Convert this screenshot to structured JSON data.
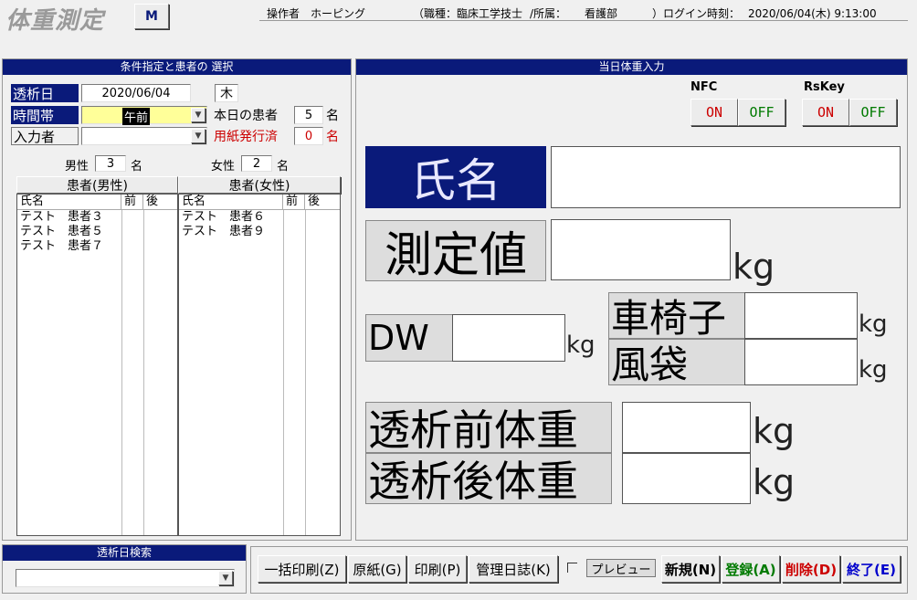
{
  "header": {
    "title": "体重測定",
    "m_button": "M",
    "operator_label": "操作者",
    "operator_name": "ホーピング",
    "job_label": "（職種：",
    "job_value": "臨床工学技士",
    "dept_label": "/所属：",
    "dept_value": "看護部",
    "login_label": "）ログイン時刻：",
    "login_time": "2020/06/04(木) 9:13:00"
  },
  "left_panel": {
    "title": "条件指定と患者の 選択",
    "date_label": "透析日",
    "date_value": "2020/06/04",
    "weekday": "木",
    "time_label": "時間帯",
    "time_value": "午前",
    "today_label": "本日の患者",
    "today_count": "5",
    "count_unit": "名",
    "inputter_label": "入力者",
    "inputter_value": "",
    "printed_label": "用紙発行済",
    "printed_count": "0",
    "printed_unit": "名",
    "male_label": "男性",
    "male_count": "3",
    "male_unit": "名",
    "female_label": "女性",
    "female_count": "2",
    "female_unit": "名",
    "male_list": {
      "title": "患者(男性)",
      "columns": [
        "氏名",
        "前",
        "後"
      ],
      "rows": [
        "テスト　患者３",
        "テスト　患者５",
        "テスト　患者７"
      ]
    },
    "female_list": {
      "title": "患者(女性)",
      "columns": [
        "氏名",
        "前",
        "後"
      ],
      "rows": [
        "テスト　患者６",
        "テスト　患者９"
      ]
    }
  },
  "search_panel": {
    "title": "透析日検索",
    "value": ""
  },
  "right_panel": {
    "title": "当日体重入力",
    "nfc_label": "NFC",
    "rskey_label": "RsKey",
    "on_label": "ON",
    "off_label": "OFF",
    "name_label": "氏名",
    "name_value": "",
    "measure_label": "測定値",
    "measure_value": "",
    "dw_label": "DW",
    "dw_value": "",
    "wheelchair_label": "車椅子",
    "wheelchair_value": "",
    "airbag_label": "風袋",
    "airbag_value": "",
    "pre_label": "透析前体重",
    "pre_value": "",
    "post_label": "透析後体重",
    "post_value": "",
    "unit": "kg"
  },
  "toolbar": {
    "bulk_print": "一括印刷(Z)",
    "original": "原紙(G)",
    "print": "印刷(P)",
    "log": "管理日誌(K)",
    "preview": "プレビュー",
    "new": "新規(N)",
    "register": "登録(A)",
    "delete": "削除(D)",
    "exit": "終了(E)"
  },
  "colors": {
    "navy": "#0a1a7a",
    "yellow_field": "#ffff99",
    "red_text": "#cc0000",
    "green_text": "#007a00",
    "blue_text": "#0000cc"
  }
}
